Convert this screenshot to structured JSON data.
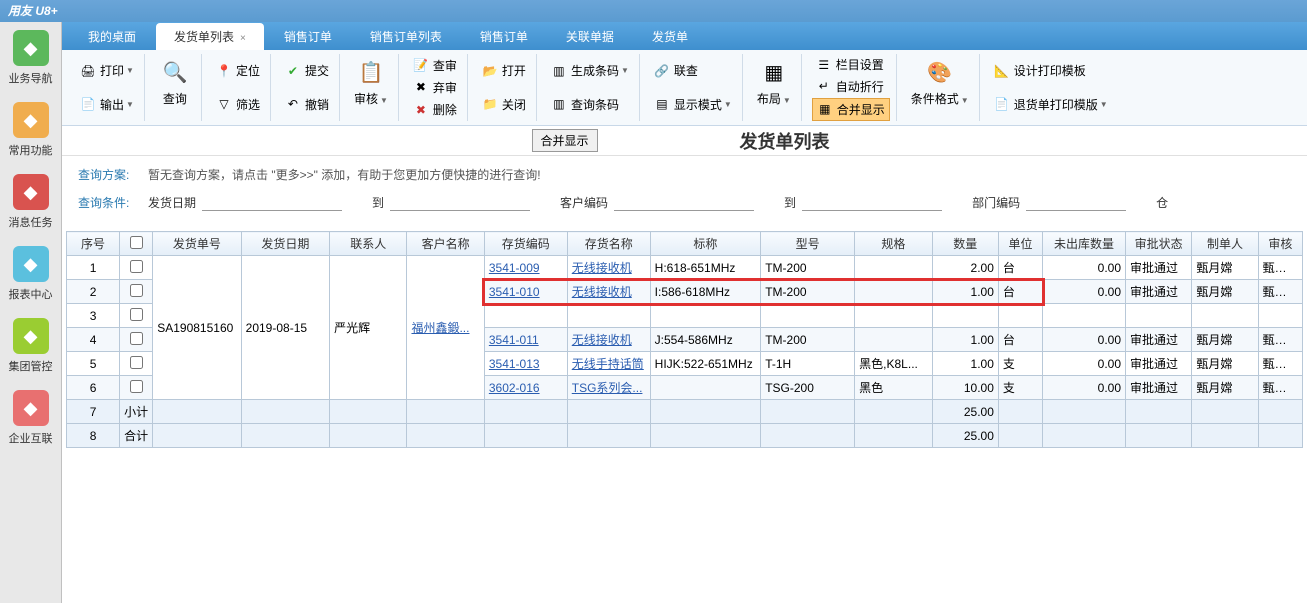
{
  "app_title": "用友 U8+",
  "sidebar": [
    {
      "label": "业务导航",
      "color": "#5cb85c"
    },
    {
      "label": "常用功能",
      "color": "#f0ad4e"
    },
    {
      "label": "消息任务",
      "color": "#d9534f"
    },
    {
      "label": "报表中心",
      "color": "#5bc0de"
    },
    {
      "label": "集团管控",
      "color": "#9acd32"
    },
    {
      "label": "企业互联",
      "color": "#e87070"
    }
  ],
  "tabs": [
    {
      "label": "我的桌面"
    },
    {
      "label": "发货单列表",
      "active": true,
      "closable": true
    },
    {
      "label": "销售订单"
    },
    {
      "label": "销售订单列表"
    },
    {
      "label": "销售订单"
    },
    {
      "label": "关联单据"
    },
    {
      "label": "发货单"
    }
  ],
  "ribbon": {
    "print": "打印",
    "output": "输出",
    "query": "查询",
    "locate": "定位",
    "filter": "筛选",
    "submit": "提交",
    "revoke": "撤销",
    "approve": "审核",
    "audit": "查审",
    "abandon": "弃审",
    "delete": "删除",
    "open": "打开",
    "close": "关闭",
    "gencode": "生成条码",
    "querycode": "查询条码",
    "linkq": "联查",
    "dispmode": "显示模式",
    "layout": "布局",
    "colset": "栏目设置",
    "autowrap": "自动折行",
    "mergeshow": "合并显示",
    "condfmt": "条件格式",
    "designprint": "设计打印模板",
    "returnprint": "退货单打印模版"
  },
  "page_title": "发货单列表",
  "merge_button": "合并显示",
  "query_scheme_label": "查询方案:",
  "query_scheme_text": "暂无查询方案，请点击 \"更多>>\" 添加，有助于您更加方便快捷的进行查询!",
  "query_cond_label": "查询条件:",
  "filters": {
    "ship_date": "发货日期",
    "to": "到",
    "cust_code": "客户编码",
    "dept_code": "部门编码",
    "warehouse": "仓"
  },
  "columns": [
    "序号",
    "",
    "发货单号",
    "发货日期",
    "联系人",
    "客户名称",
    "存货编码",
    "存货名称",
    "标称",
    "型号",
    "规格",
    "数量",
    "单位",
    "未出库数量",
    "审批状态",
    "制单人",
    "审核"
  ],
  "merged": {
    "ship_no": "SA190815160",
    "ship_date": "2019-08-15",
    "contact": "严光辉",
    "customer": "福州鑫鍛..."
  },
  "rows": [
    {
      "seq": "1",
      "code": "3541-009",
      "name": "无线接收机",
      "spec": "H:618-651MHz",
      "model": "TM-200",
      "std": "",
      "qty": "2.00",
      "unit": "台",
      "unout": "0.00",
      "status": "审批通过",
      "maker": "甄月嫦",
      "auditor": "甄月嫦"
    },
    {
      "seq": "2",
      "code": "3541-010",
      "name": "无线接收机",
      "spec": "I:586-618MHz",
      "model": "TM-200",
      "std": "",
      "qty": "1.00",
      "unit": "台",
      "unout": "0.00",
      "status": "审批通过",
      "maker": "甄月嫦",
      "auditor": "甄月嫦",
      "highlight": true
    },
    {
      "seq": "3",
      "code": "",
      "name": "",
      "spec": "",
      "model": "",
      "std": "",
      "qty": "",
      "unit": "",
      "unout": "",
      "status": "",
      "maker": "",
      "auditor": ""
    },
    {
      "seq": "4",
      "code": "3541-011",
      "name": "无线接收机",
      "spec": "J:554-586MHz",
      "model": "TM-200",
      "std": "",
      "qty": "1.00",
      "unit": "台",
      "unout": "0.00",
      "status": "审批通过",
      "maker": "甄月嫦",
      "auditor": "甄月嫦"
    },
    {
      "seq": "5",
      "code": "3541-013",
      "name": "无线手持话筒",
      "spec": "HIJK:522-651MHz",
      "model": "T-1H",
      "std": "黑色,K8L...",
      "qty": "1.00",
      "unit": "支",
      "unout": "0.00",
      "status": "审批通过",
      "maker": "甄月嫦",
      "auditor": "甄月嫦"
    },
    {
      "seq": "6",
      "code": "3602-016",
      "name": "TSG系列会...",
      "spec": "",
      "model": "TSG-200",
      "std": "黑色",
      "qty": "10.00",
      "unit": "支",
      "unout": "0.00",
      "status": "审批通过",
      "maker": "甄月嫦",
      "auditor": "甄月嫦"
    }
  ],
  "subtotal": {
    "seq": "7",
    "label": "小计",
    "qty": "25.00"
  },
  "total": {
    "seq": "8",
    "label": "合计",
    "qty": "25.00"
  }
}
